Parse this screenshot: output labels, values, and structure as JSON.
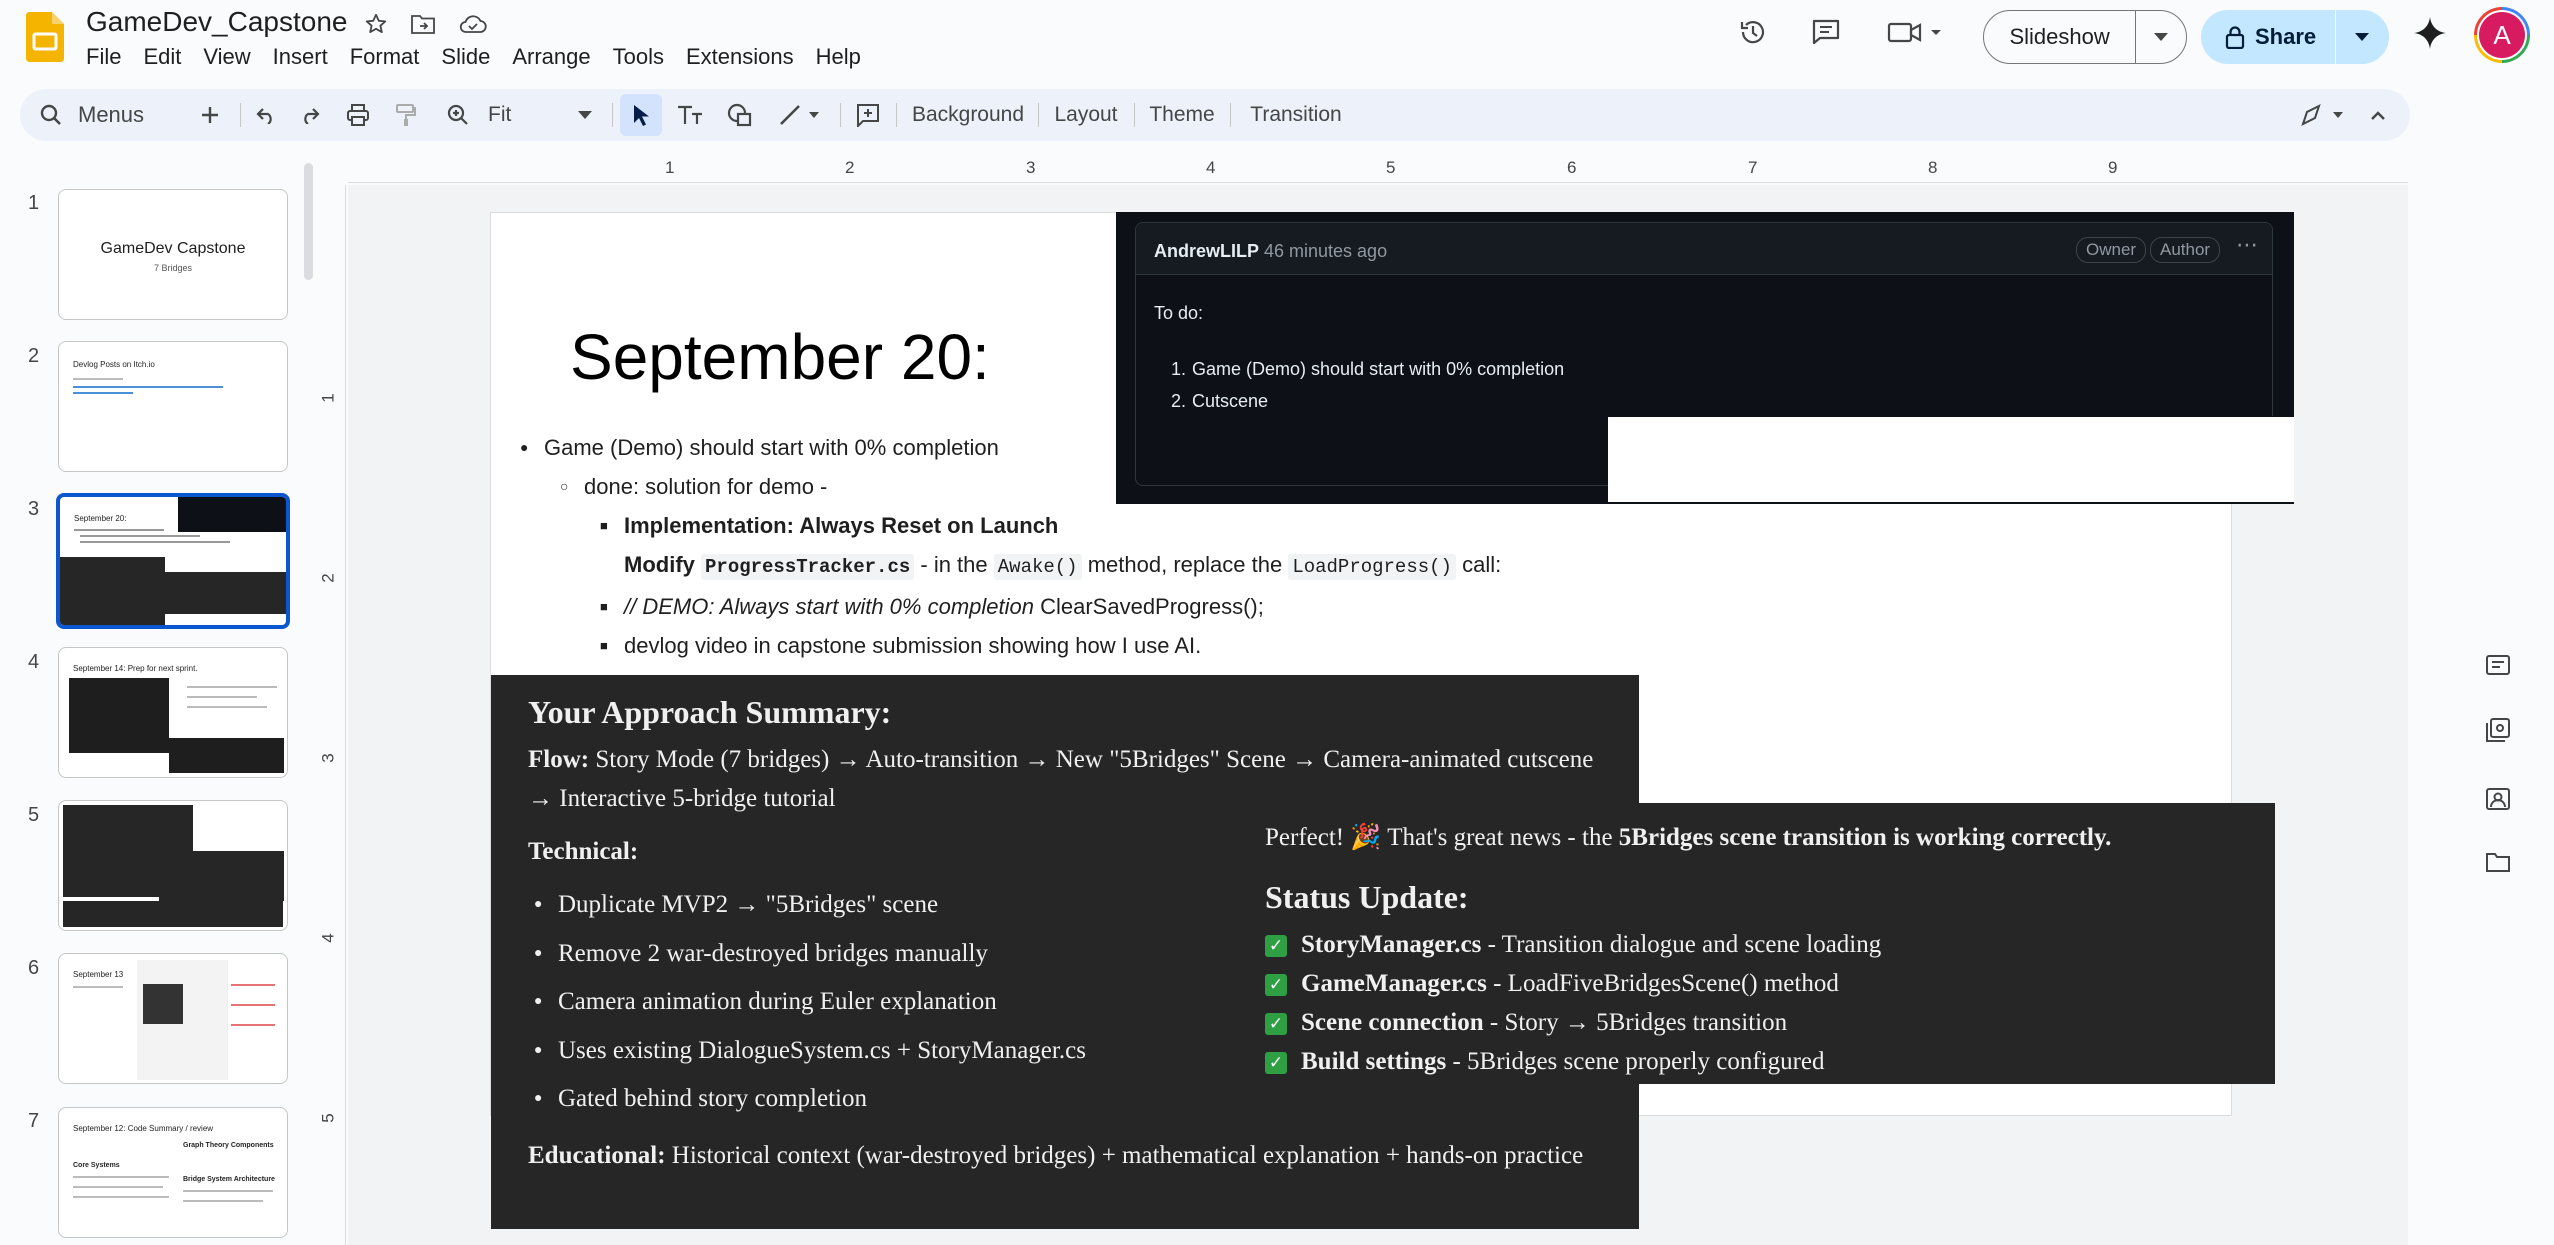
{
  "app": {
    "doc_title": "GameDev_Capstone",
    "menu": [
      "File",
      "Edit",
      "View",
      "Insert",
      "Format",
      "Slide",
      "Arrange",
      "Tools",
      "Extensions",
      "Help"
    ],
    "slideshow_label": "Slideshow",
    "share_label": "Share",
    "avatar_letter": "A",
    "brand_color": "#f4b400",
    "share_bg": "#c2e7ff",
    "avatar_ring": "#e8453c"
  },
  "toolbar": {
    "search_label": "Menus",
    "zoom_label": "Fit",
    "background_label": "Background",
    "layout_label": "Layout",
    "theme_label": "Theme",
    "transition_label": "Transition"
  },
  "ruler": {
    "h": [
      "1",
      "2",
      "3",
      "4",
      "5",
      "6",
      "7",
      "8",
      "9"
    ],
    "v": [
      "1",
      "2",
      "3",
      "4",
      "5"
    ]
  },
  "filmstrip": [
    {
      "num": "1",
      "title": "GameDev Capstone",
      "subtitle": "7 Bridges"
    },
    {
      "num": "2",
      "title": "Devlog Posts on Itch.io"
    },
    {
      "num": "3",
      "title": "September 20:"
    },
    {
      "num": "4",
      "title": "September 14: Prep for next sprint."
    },
    {
      "num": "5",
      "title": ""
    },
    {
      "num": "6",
      "title": "September 13"
    },
    {
      "num": "7",
      "title": "September 12: Code Summary / review",
      "sub1": "Core Systems",
      "sub2": "Graph Theory Components",
      "sub3": "Bridge System Architecture"
    }
  ],
  "slide": {
    "title": "September 20:",
    "b1": "Game (Demo) should start with 0% completion",
    "b2": "done: solution for demo -",
    "b3": "Implementation: Always Reset on Launch",
    "b4_pre": "Modify",
    "b4_code1": "ProgressTracker.cs",
    "b4_mid1": "- in the",
    "b4_code2": "Awake()",
    "b4_mid2": "method, replace the",
    "b4_code3": "LoadProgress()",
    "b4_post": "call:",
    "b5_italic": "// DEMO: Always start with 0% completion",
    "b5_rest": "ClearSavedProgress();",
    "b6": "devlog video in capstone submission showing how I use AI."
  },
  "comment": {
    "author": "AndrewLILP",
    "time": "46 minutes ago",
    "badge1": "Owner",
    "badge2": "Author",
    "body_intro": "To do:",
    "items": [
      "Game (Demo) should start with 0% completion",
      "Cutscene"
    ]
  },
  "summary": {
    "heading": "Your Approach Summary:",
    "flow_label": "Flow:",
    "flow_text": "Story Mode (7 bridges) → Auto-transition → New \"5Bridges\" Scene → Camera-animated cutscene → Interactive 5-bridge tutorial",
    "technical_label": "Technical:",
    "technical_items": [
      "Duplicate MVP2 → \"5Bridges\" scene",
      "Remove 2 war-destroyed bridges manually",
      "Camera animation during Euler explanation",
      "Uses existing DialogueSystem.cs + StoryManager.cs",
      "Gated behind story completion"
    ],
    "educational_label": "Educational:",
    "educational_text": "Historical context (war-destroyed bridges) + mathematical explanation + hands-on practice"
  },
  "status": {
    "intro_pre": "Perfect! 🎉 That's great news - the",
    "intro_bold": "5Bridges scene transition is working correctly.",
    "heading": "Status Update:",
    "items": [
      {
        "bold": "StoryManager.cs",
        "rest": "- Transition dialogue and scene loading"
      },
      {
        "bold": "GameManager.cs",
        "rest": "- LoadFiveBridgesScene() method"
      },
      {
        "bold": "Scene connection",
        "rest": "- Story → 5Bridges transition"
      },
      {
        "bold": "Build settings",
        "rest": "- 5Bridges scene properly configured"
      }
    ]
  }
}
